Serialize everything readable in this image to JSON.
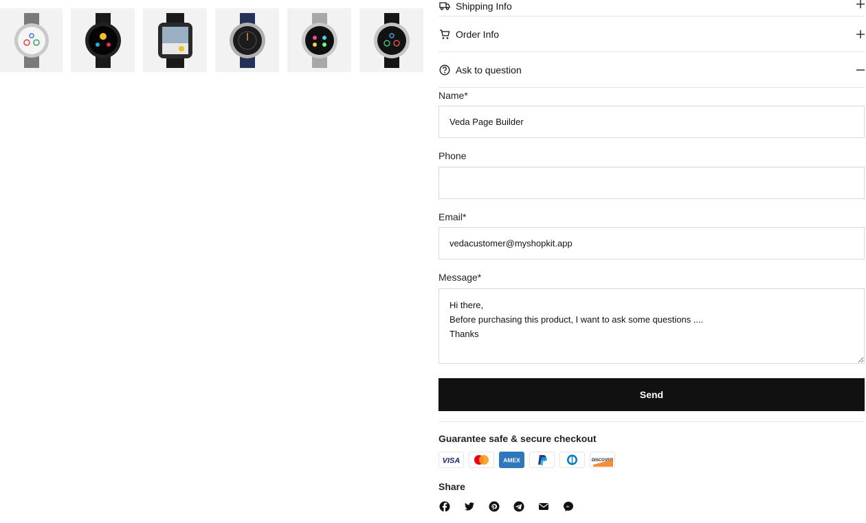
{
  "gallery": {
    "thumbnails": [
      {
        "icon": "watch-silver-grey-strap-icon"
      },
      {
        "icon": "watch-black-galaxy-icon"
      },
      {
        "icon": "watch-square-black-icon"
      },
      {
        "icon": "watch-navy-strap-icon"
      },
      {
        "icon": "watch-silver-mesh-icon"
      },
      {
        "icon": "watch-silver-black-strap-icon"
      }
    ]
  },
  "accordion": {
    "shipping": {
      "label": "Shipping Info",
      "icon": "truck-icon",
      "state": "collapsed"
    },
    "order": {
      "label": "Order Info",
      "icon": "cart-icon",
      "state": "collapsed"
    },
    "ask": {
      "label": "Ask to question",
      "icon": "question-circle-icon",
      "state": "expanded"
    }
  },
  "form": {
    "name_label": "Name*",
    "name_value": "Veda Page Builder",
    "phone_label": "Phone",
    "phone_value": "",
    "email_label": "Email*",
    "email_value": "vedacustomer@myshopkit.app",
    "message_label": "Message*",
    "message_value": "Hi there,\nBefore purchasing this product, I want to ask some questions ....\nThanks",
    "send_label": "Send"
  },
  "checkout": {
    "title": "Guarantee safe & secure checkout",
    "payments": [
      "visa-icon",
      "mastercard-icon",
      "amex-icon",
      "paypal-icon",
      "diners-icon",
      "discover-icon"
    ],
    "visa_text": "VISA",
    "amex_text": "AMEX",
    "discover_text": "DISCOVER"
  },
  "share": {
    "title": "Share",
    "icons": [
      "facebook-icon",
      "twitter-icon",
      "pinterest-icon",
      "telegram-icon",
      "email-icon",
      "messenger-icon"
    ]
  },
  "colors": {
    "button_bg": "#111111",
    "border": "#d9d9d9",
    "visa": "#1a1f71",
    "mastercard_red": "#eb001b",
    "mastercard_orange": "#f79e1b",
    "amex": "#2e77bc",
    "paypal": "#253b80",
    "diners": "#0079be",
    "discover_orange": "#f48120"
  }
}
